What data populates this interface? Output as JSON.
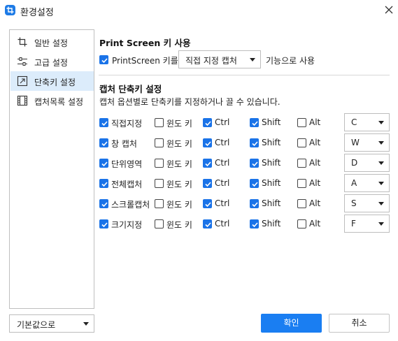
{
  "window": {
    "title": "환경설정"
  },
  "sidebar": {
    "items": [
      {
        "label": "일반 설정",
        "icon": "crop-icon"
      },
      {
        "label": "고급 설정",
        "icon": "sliders-icon"
      },
      {
        "label": "단축키 설정",
        "icon": "shortcut-arrow-icon",
        "active": true
      },
      {
        "label": "캡처목록 설정",
        "icon": "film-list-icon"
      }
    ]
  },
  "print_screen": {
    "section_title": "Print Screen 키 사용",
    "checkbox_label": "PrintScreen 키를",
    "checked": true,
    "select_value": "직접 지정 캡처",
    "suffix": "기능으로 사용"
  },
  "shortcuts": {
    "section_title": "캡처 단축키 설정",
    "description": "캡처 옵션별로 단축키를 지정하거나 끌 수 있습니다.",
    "modifier_labels": {
      "win": "윈도 키",
      "ctrl": "Ctrl",
      "shift": "Shift",
      "alt": "Alt"
    },
    "rows": [
      {
        "label": "직접지정",
        "enabled": true,
        "win": false,
        "ctrl": true,
        "shift": true,
        "alt": false,
        "key": "C"
      },
      {
        "label": "창 캡처",
        "enabled": true,
        "win": false,
        "ctrl": true,
        "shift": true,
        "alt": false,
        "key": "W"
      },
      {
        "label": "단위영역",
        "enabled": true,
        "win": false,
        "ctrl": true,
        "shift": true,
        "alt": false,
        "key": "D"
      },
      {
        "label": "전체캡처",
        "enabled": true,
        "win": false,
        "ctrl": true,
        "shift": true,
        "alt": false,
        "key": "A"
      },
      {
        "label": "스크롤캡처",
        "enabled": true,
        "win": false,
        "ctrl": true,
        "shift": true,
        "alt": false,
        "key": "S"
      },
      {
        "label": "크기지정",
        "enabled": true,
        "win": false,
        "ctrl": true,
        "shift": true,
        "alt": false,
        "key": "F"
      }
    ]
  },
  "footer": {
    "defaults_label": "기본값으로",
    "ok_label": "확인",
    "cancel_label": "취소"
  },
  "colors": {
    "accent": "#1a7ef2",
    "selected_bg": "#dcecfb"
  }
}
